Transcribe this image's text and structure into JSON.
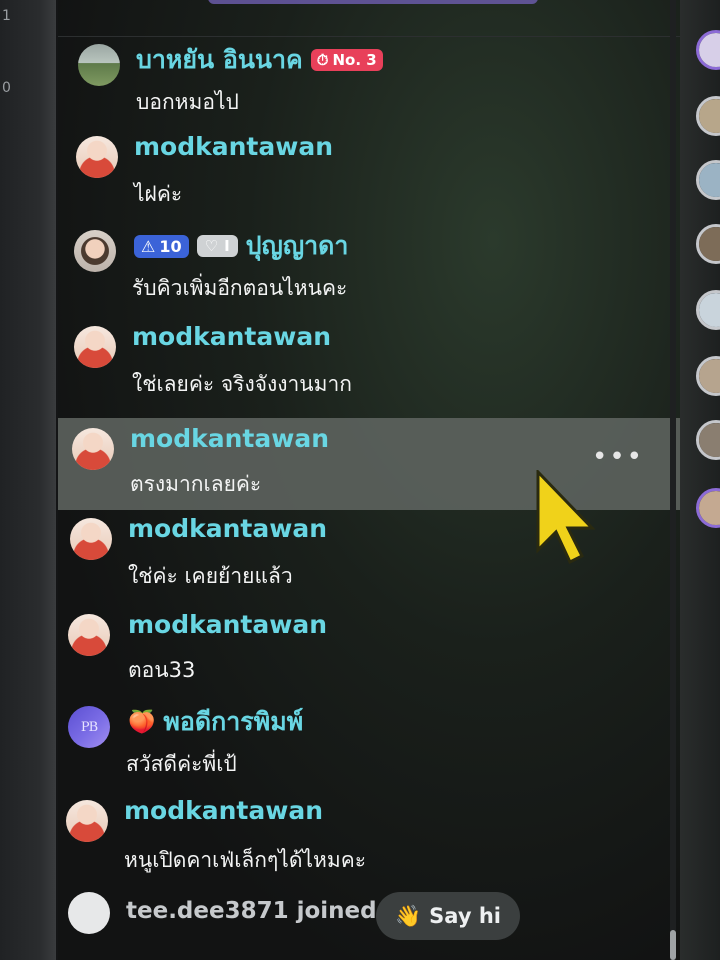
{
  "messages": [
    {
      "name": "บาหยัน อินนาค",
      "text": "บอกหมอไป",
      "badge_rank": "No. 3",
      "avatar": "banner-avatar"
    },
    {
      "name": "modkantawan",
      "text": "ไฝค่ะ",
      "avatar": "modkantawan-avatar"
    },
    {
      "name": "ปุญญาดา",
      "text": "รับคิวเพิ่มอีกตอนไหนคะ",
      "badge_level": "10",
      "badge_heart": "I",
      "avatar": "lady-avatar"
    },
    {
      "name": "modkantawan",
      "text": "ใช่เลยค่ะ จริงจังงานมาก",
      "avatar": "modkantawan-avatar"
    },
    {
      "name": "modkantawan",
      "text": "ตรงมากเลยค่ะ",
      "avatar": "modkantawan-avatar",
      "hovered": true,
      "more": "•••"
    },
    {
      "name": "modkantawan",
      "text": "ใช่ค่ะ เคยย้ายแล้ว",
      "avatar": "modkantawan-avatar"
    },
    {
      "name": "modkantawan",
      "text": "ตอน33",
      "avatar": "modkantawan-avatar"
    },
    {
      "name": "พอดีการพิมพ์",
      "text": "สวัสดีค่ะพี่เป้",
      "avatar": "pb-avatar",
      "avatar_text": "PB"
    },
    {
      "name": "modkantawan",
      "text": "หนูเปิดคาเฟ่เล็กๆได้ไหมคะ",
      "avatar": "modkantawan-avatar"
    }
  ],
  "joined": {
    "text": "tee.dee3871 joined",
    "button_label": "Say hi",
    "button_icon": "👋"
  },
  "left_strip": {
    "marks": [
      "1",
      "0"
    ]
  },
  "colors": {
    "username": "#69d6e3",
    "message_text": "#f3f4f4",
    "rank_badge": "#e8405a",
    "level_badge": "#3b63d8",
    "hover_row": "#5f6460",
    "cursor": "#f0d21a"
  }
}
